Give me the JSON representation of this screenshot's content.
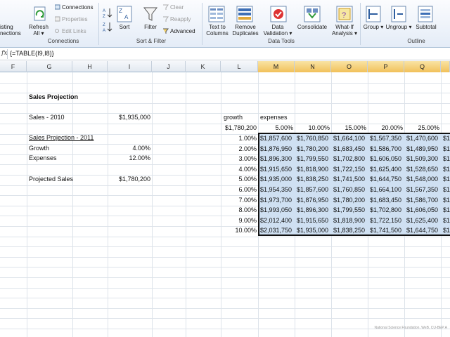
{
  "ribbon": {
    "connections": {
      "existing": "isting",
      "existing2": "nections",
      "refresh": "Refresh",
      "refresh_all": "All",
      "connections": "Connections",
      "properties": "Properties",
      "edit_links": "Edit Links",
      "group_label": "Connections"
    },
    "sort_filter": {
      "sort": "Sort",
      "filter": "Filter",
      "clear": "Clear",
      "reapply": "Reapply",
      "advanced": "Advanced",
      "group_label": "Sort & Filter"
    },
    "data_tools": {
      "text_to_columns_1": "Text to",
      "text_to_columns_2": "Columns",
      "remove_duplicates_1": "Remove",
      "remove_duplicates_2": "Duplicates",
      "data_validation_1": "Data",
      "data_validation_2": "Validation",
      "consolidate": "Consolidate",
      "what_if_1": "What-If",
      "what_if_2": "Analysis",
      "group_label": "Data Tools"
    },
    "outline": {
      "group": "Group",
      "ungroup": "Ungroup",
      "subtotal": "Subtotal",
      "group_label": "Outline"
    }
  },
  "formula_bar": {
    "fx": "fx",
    "formula": "{=TABLE(I9,I8)}"
  },
  "columns": [
    "F",
    "G",
    "H",
    "I",
    "J",
    "K",
    "L",
    "M",
    "N",
    "O",
    "P",
    "Q"
  ],
  "cells": {
    "title": "Sales Projection",
    "sales_2010_label": "Sales - 2010",
    "sales_2010_value": "$1,935,000",
    "proj_2011": "Sales Projection - 2011",
    "growth_label": "Growth",
    "growth_value": "4.00%",
    "expenses_label": "Expenses",
    "expenses_value": "12.00%",
    "projected_label": "Projected Sales",
    "projected_value": "$1,780,200",
    "growth_header": "growth",
    "expenses_header": "expenses",
    "corner_value": "$1,780,200"
  },
  "expense_rates": [
    "5.00%",
    "10.00%",
    "15.00%",
    "20.00%",
    "25.00%"
  ],
  "growth_rates": [
    "1.00%",
    "2.00%",
    "3.00%",
    "4.00%",
    "5.00%",
    "6.00%",
    "7.00%",
    "8.00%",
    "9.00%",
    "10.00%"
  ],
  "table": [
    [
      "$1,857,600",
      "$1,760,850",
      "$1,664,100",
      "$1,567,350",
      "$1,470,600",
      "$1"
    ],
    [
      "$1,876,950",
      "$1,780,200",
      "$1,683,450",
      "$1,586,700",
      "$1,489,950",
      "$1"
    ],
    [
      "$1,896,300",
      "$1,799,550",
      "$1,702,800",
      "$1,606,050",
      "$1,509,300",
      "$1"
    ],
    [
      "$1,915,650",
      "$1,818,900",
      "$1,722,150",
      "$1,625,400",
      "$1,528,650",
      "$1"
    ],
    [
      "$1,935,000",
      "$1,838,250",
      "$1,741,500",
      "$1,644,750",
      "$1,548,000",
      "$1"
    ],
    [
      "$1,954,350",
      "$1,857,600",
      "$1,760,850",
      "$1,664,100",
      "$1,567,350",
      "$1"
    ],
    [
      "$1,973,700",
      "$1,876,950",
      "$1,780,200",
      "$1,683,450",
      "$1,586,700",
      "$1"
    ],
    [
      "$1,993,050",
      "$1,896,300",
      "$1,799,550",
      "$1,702,800",
      "$1,606,050",
      "$1"
    ],
    [
      "$2,012,400",
      "$1,915,650",
      "$1,818,900",
      "$1,722,150",
      "$1,625,400",
      "$1"
    ],
    [
      "$2,031,750",
      "$1,935,000",
      "$1,838,250",
      "$1,741,500",
      "$1,644,750",
      "$1"
    ]
  ],
  "watermark": "National Science Foundation, WeB, CU-BEP A",
  "colors": {
    "selection_fill": "#cfe0f2",
    "selected_header": "#f1c15a",
    "ribbon_bg": "#e4ecf7"
  }
}
